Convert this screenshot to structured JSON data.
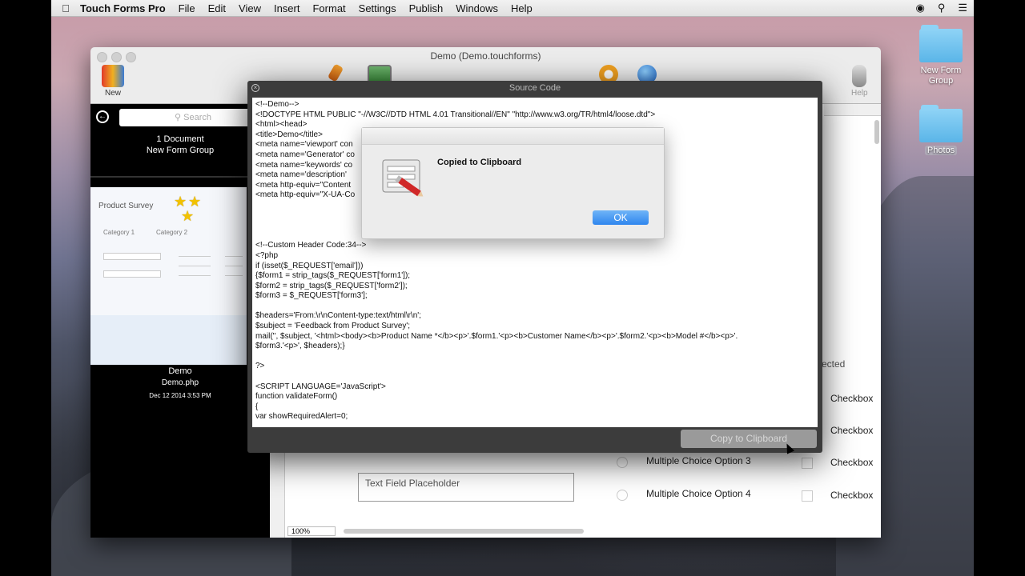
{
  "menubar": {
    "app_name": "Touch Forms Pro",
    "items": [
      "File",
      "Edit",
      "View",
      "Insert",
      "Format",
      "Settings",
      "Publish",
      "Windows",
      "Help"
    ]
  },
  "desktop": {
    "icons": [
      {
        "label": "New Form\nGroup"
      },
      {
        "label": "Photos"
      }
    ]
  },
  "window": {
    "title": "Demo (Demo.touchforms)",
    "toolbar": {
      "new_label": "New",
      "help_label": "Help"
    }
  },
  "sidebar": {
    "search_placeholder": "Search",
    "doc_count": "1 Document",
    "group_name": "New Form Group",
    "thumb_title": "Product Survey",
    "thumb_cat1": "Category 1",
    "thumb_cat2": "Category 2",
    "doc_name": "Demo",
    "doc_file": "Demo.php",
    "doc_date": "Dec 12 2014 3:53 PM"
  },
  "content": {
    "right_text": "ected",
    "checkbox_labels": [
      "Checkbox",
      "Checkbox",
      "Checkbox",
      "Checkbox"
    ],
    "mc_options": [
      "Multiple Choice Option 3",
      "Multiple Choice Option 4"
    ],
    "text_field_placeholder": "Text Field Placeholder",
    "zoom": "100%"
  },
  "source_panel": {
    "title": "Source Code",
    "code": "<!--Demo-->\n<!DOCTYPE HTML PUBLIC \"-//W3C//DTD HTML 4.01 Transitional//EN\" \"http://www.w3.org/TR/html4/loose.dtd\">\n<html><head>\n<title>Demo</title>\n<meta name='viewport' con\n<meta name='Generator' co\n<meta name='keywords' co\n<meta name='description' \n<meta http-equiv=\"Content\n<meta http-equiv=\"X-UA-Co\n\n\n\n\n<!--Custom Header Code:34-->\n<?php\nif (isset($_REQUEST['email']))\n{$form1 = strip_tags($_REQUEST['form1']);\n$form2 = strip_tags($_REQUEST['form2']);\n$form3 = $_REQUEST['form3'];\n\n$headers='From:\\r\\nContent-type:text/html\\r\\n';\n$subject = 'Feedback from Product Survey';\nmail('', $subject, '<html><body><b>Product Name *</b><p>'.$form1.'<p><b>Customer Name</b><p>'.$form2.'<p><b>Model #</b><p>'.\n$form3.'<p>', $headers);}\n\n?>\n\n<SCRIPT LANGUAGE='JavaScript'>\nfunction validateForm()\n{\nvar showRequiredAlert=0;",
    "copy_button": "Copy to Clipboard"
  },
  "alert": {
    "message": "Copied to Clipboard",
    "ok_label": "OK"
  }
}
